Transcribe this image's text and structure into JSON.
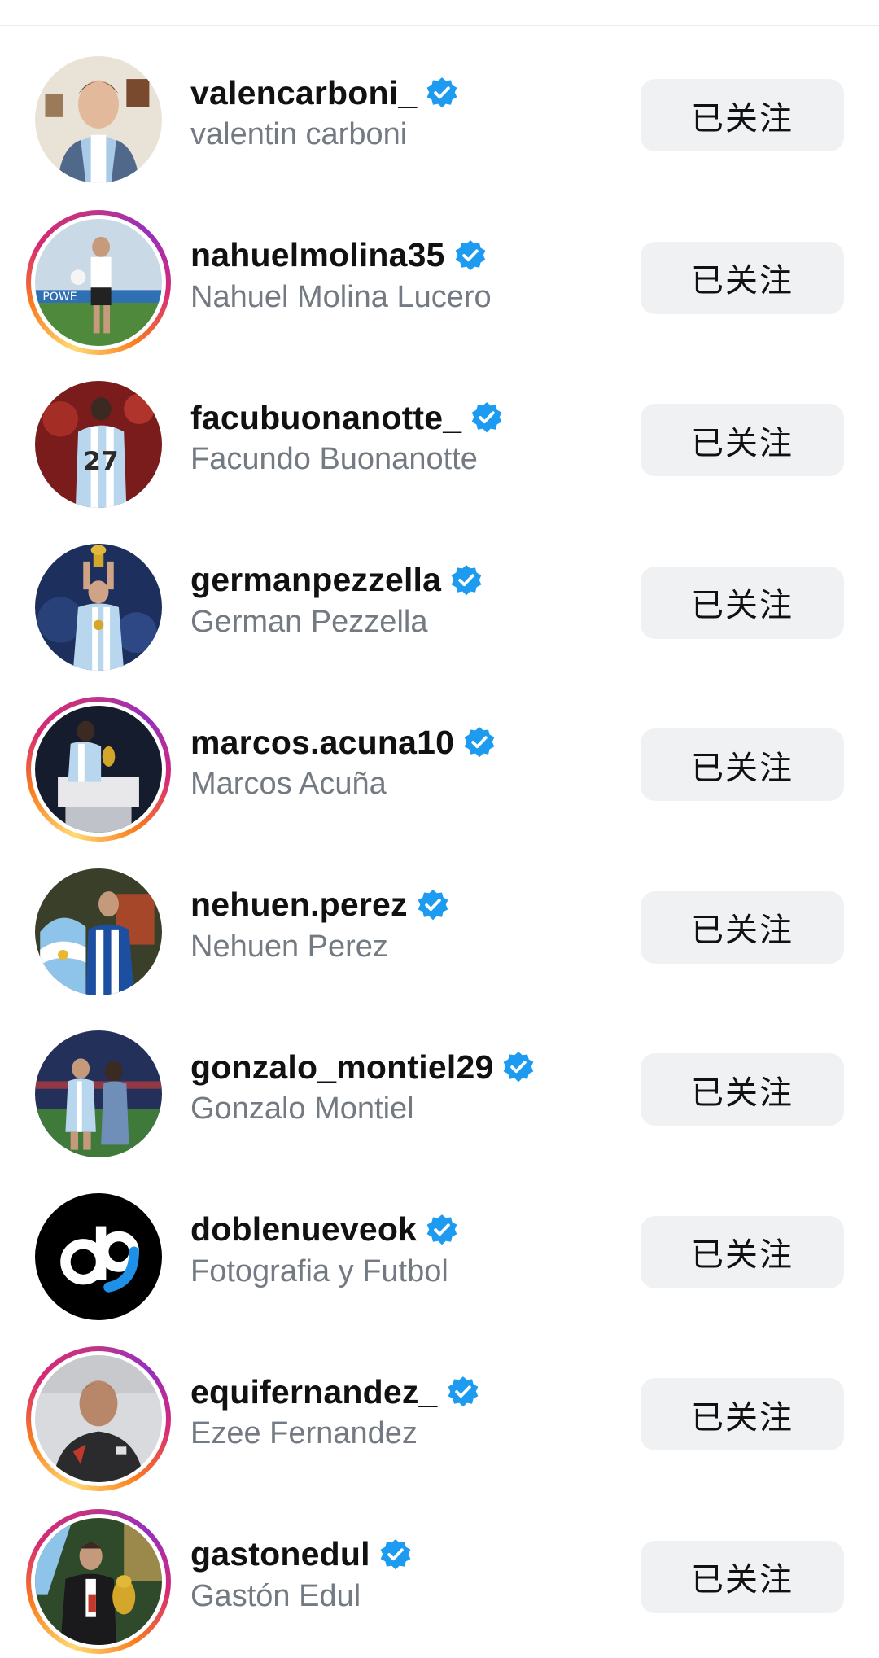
{
  "follow_label": "已关注",
  "accounts": [
    {
      "username": "valencarboni_",
      "full_name": "valentin carboni",
      "verified": true,
      "story_ring": false,
      "avatar": "player-portrait"
    },
    {
      "username": "nahuelmolina35",
      "full_name": "Nahuel Molina Lucero",
      "verified": true,
      "story_ring": true,
      "avatar": "player-on-pitch"
    },
    {
      "username": "facubuonanotte_",
      "full_name": "Facundo Buonanotte",
      "verified": true,
      "story_ring": false,
      "avatar": "player-back-27"
    },
    {
      "username": "germanpezzella",
      "full_name": "German Pezzella",
      "verified": true,
      "story_ring": false,
      "avatar": "player-trophy-raise"
    },
    {
      "username": "marcos.acuna10",
      "full_name": "Marcos Acuña",
      "verified": true,
      "story_ring": true,
      "avatar": "player-trophy-pedestal"
    },
    {
      "username": "nehuen.perez",
      "full_name": "Nehuen Perez",
      "verified": true,
      "story_ring": false,
      "avatar": "player-flag"
    },
    {
      "username": "gonzalo_montiel29",
      "full_name": "Gonzalo Montiel",
      "verified": true,
      "story_ring": false,
      "avatar": "player-couple-stadium"
    },
    {
      "username": "doblenueveok",
      "full_name": "Fotografia y Futbol",
      "verified": true,
      "story_ring": false,
      "avatar": "d9-logo"
    },
    {
      "username": "equifernandez_",
      "full_name": "Ezee Fernandez",
      "verified": true,
      "story_ring": true,
      "avatar": "player-headshot"
    },
    {
      "username": "gastonedul",
      "full_name": "Gastón Edul",
      "verified": true,
      "story_ring": true,
      "avatar": "reporter-trophy"
    }
  ],
  "colors": {
    "verified_badge": "#1d9bf0",
    "button_bg": "#eff1f3",
    "fullname_text": "#737a82",
    "story_ring": [
      "#feda75",
      "#fa7e1e",
      "#d62976",
      "#962fbf"
    ]
  }
}
